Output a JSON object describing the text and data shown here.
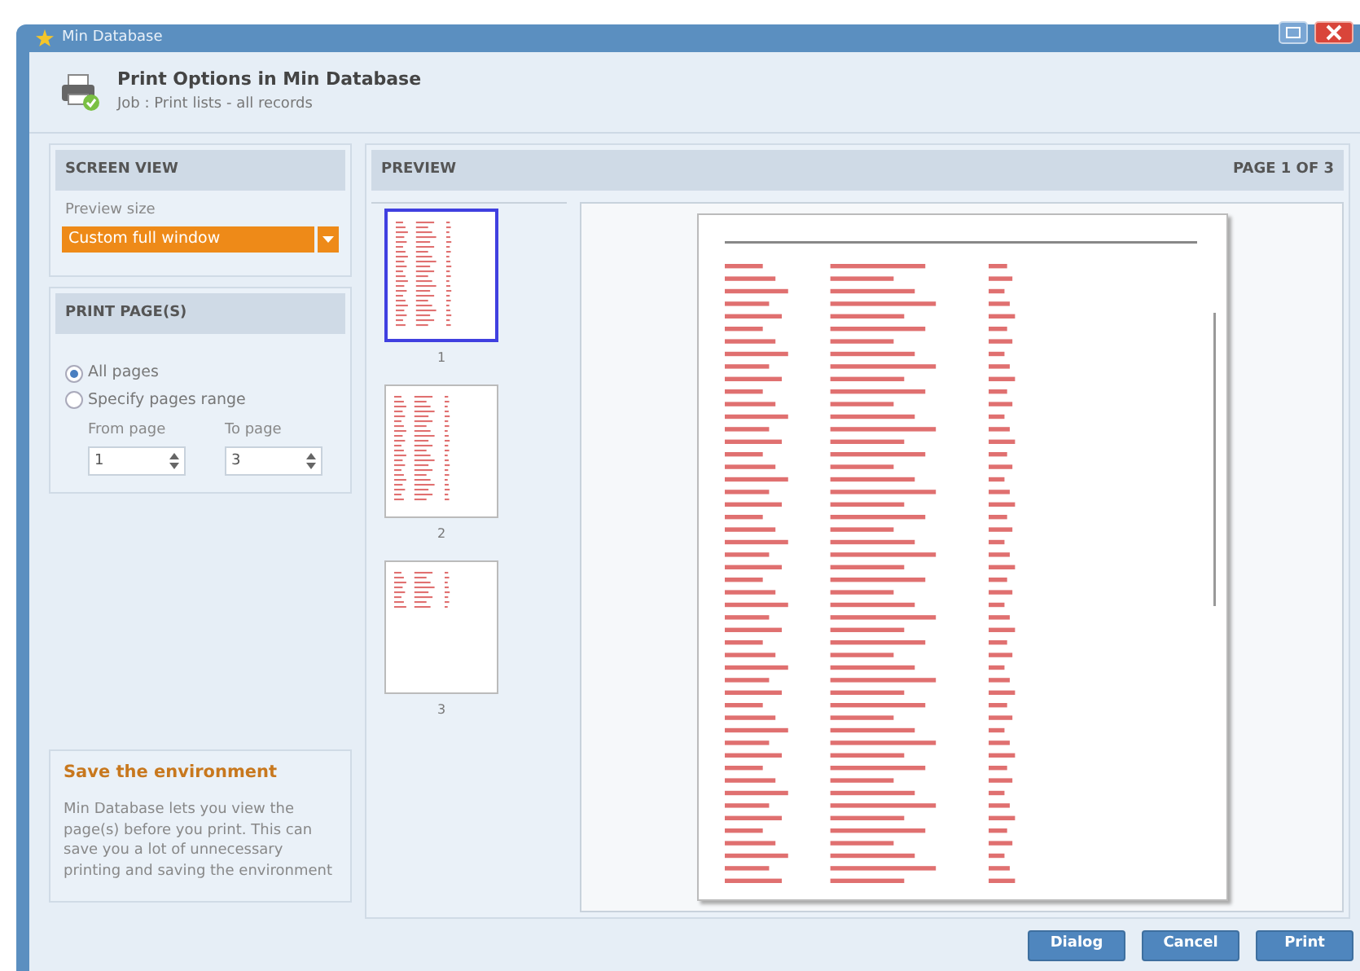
{
  "window": {
    "title": "Min Database"
  },
  "header": {
    "title": "Print Options in Min Database",
    "subtitle": "Job : Print lists - all records"
  },
  "screen_view": {
    "heading": "SCREEN VIEW",
    "label": "Preview size",
    "value": "Custom full window"
  },
  "print_pages": {
    "heading": "PRINT PAGE(S)",
    "options": [
      {
        "label": "All pages",
        "selected": true
      },
      {
        "label": "Specify pages range",
        "selected": false
      }
    ],
    "from": {
      "label": "From page",
      "value": "1"
    },
    "to": {
      "label": "To page",
      "value": "3"
    }
  },
  "tip": {
    "title": "Save the environment",
    "text": "Min Database lets you view the page(s) before you print. This can save you a lot of unnecessary printing and saving the environment"
  },
  "preview": {
    "heading": "PREVIEW",
    "page_indicator": "PAGE 1 OF 3",
    "thumbnails": [
      {
        "label": "1",
        "selected": true
      },
      {
        "label": "2",
        "selected": false
      },
      {
        "label": "3",
        "selected": false
      }
    ]
  },
  "buttons": [
    "Dialog",
    "Cancel",
    "Print"
  ]
}
